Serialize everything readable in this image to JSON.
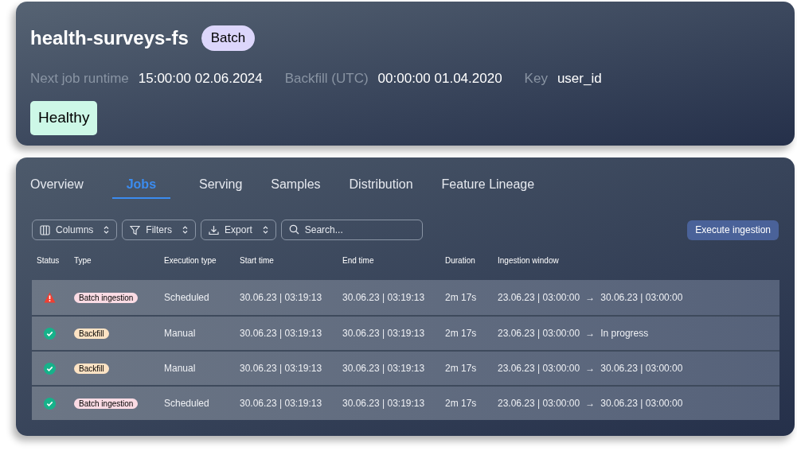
{
  "header": {
    "title": "health-surveys-fs",
    "badge": "Batch",
    "meta": [
      {
        "label": "Next job runtime",
        "value": "15:00:00 02.06.2024"
      },
      {
        "label": "Backfill (UTC)",
        "value": "00:00:00 01.04.2020"
      },
      {
        "label": "Key",
        "value": "user_id"
      }
    ],
    "health": "Healthy"
  },
  "tabs": [
    {
      "label": "Overview",
      "selected": false
    },
    {
      "label": "Jobs",
      "selected": true
    },
    {
      "label": "Serving",
      "selected": false
    },
    {
      "label": "Samples",
      "selected": false
    },
    {
      "label": "Distribution",
      "selected": false
    },
    {
      "label": "Feature Lineage",
      "selected": false
    }
  ],
  "toolbar": {
    "dropdowns": [
      {
        "kind": "columns",
        "label": "Columns"
      },
      {
        "kind": "filters",
        "label": "Filters"
      },
      {
        "kind": "export",
        "label": "Export"
      }
    ],
    "search": {
      "placeholder": "Search..."
    },
    "action": "Execute ingestion"
  },
  "table": {
    "columns": [
      "Status",
      "Type",
      "Execution type",
      "Start time",
      "End time",
      "Duration",
      "Ingestion window"
    ],
    "rows": [
      {
        "kind": "error",
        "type": "Batch ingestion",
        "color": "#fbdbe4",
        "execution": "Scheduled",
        "start": "30.06.23 | 03:19:13",
        "end": "30.06.23 | 03:19:13",
        "duration": "2m 17s",
        "from": "23.06.23 | 03:00:00",
        "to": "30.06.23 | 03:00:00"
      },
      {
        "kind": "success",
        "type": "Backfill",
        "color": "#fde3c4",
        "execution": "Manual",
        "start": "30.06.23 | 03:19:13",
        "end": "30.06.23 | 03:19:13",
        "duration": "2m 17s",
        "from": "23.06.23 | 03:00:00",
        "to": "In progress"
      },
      {
        "kind": "success",
        "type": "Backfill",
        "color": "#fde3c4",
        "execution": "Manual",
        "start": "30.06.23 | 03:19:13",
        "end": "30.06.23 | 03:19:13",
        "duration": "2m 17s",
        "from": "23.06.23 | 03:00:00",
        "to": "30.06.23 | 03:00:00"
      },
      {
        "kind": "success",
        "type": "Batch ingestion",
        "color": "#fbdbe4",
        "execution": "Scheduled",
        "start": "30.06.23 | 03:19:13",
        "end": "30.06.23 | 03:19:13",
        "duration": "2m 17s",
        "from": "23.06.23 | 03:00:00",
        "to": "30.06.23 | 03:00:00"
      }
    ],
    "arrow": "→"
  }
}
